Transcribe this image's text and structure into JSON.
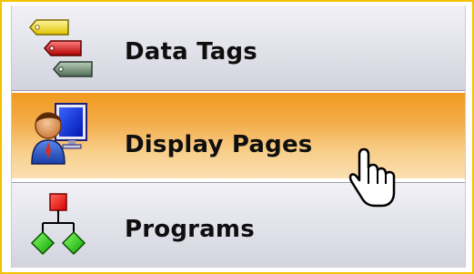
{
  "menu": {
    "items": [
      {
        "label": "Data Tags",
        "icon": "tags-icon",
        "state": "normal"
      },
      {
        "label": "Display Pages",
        "icon": "operator-display-icon",
        "state": "hover"
      },
      {
        "label": "Programs",
        "icon": "program-flowchart-icon",
        "state": "normal"
      }
    ]
  },
  "colors": {
    "frame": "#f2c200",
    "hover_top": "#f09a1e",
    "hover_bottom": "#fbe0b2",
    "normal_top": "#f1f1f6",
    "normal_bottom": "#d3d3de"
  },
  "cursor": {
    "icon": "hand-pointer-icon"
  }
}
